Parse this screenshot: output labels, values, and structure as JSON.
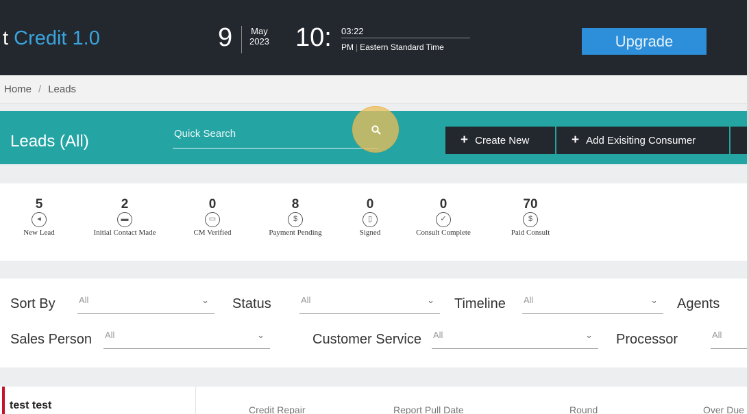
{
  "header": {
    "brand_prefix": "t",
    "brand_name": "Credit 1.0",
    "date": {
      "day": "9",
      "month": "May",
      "year": "2023"
    },
    "time": {
      "hour": "10:",
      "minutes": "03:22",
      "ampm": "PM",
      "timezone": "Eastern Standard Time"
    },
    "upgrade_label": "Upgrade"
  },
  "breadcrumb": {
    "home": "Home",
    "separator": "/",
    "current": "Leads"
  },
  "banner": {
    "title": "Leads (All)",
    "search_placeholder": "Quick Search",
    "create_label": "Create New",
    "add_label": "Add Exisiting Consumer",
    "plus": "+"
  },
  "stats": [
    {
      "count": "5",
      "label": "New Lead",
      "icon": "megaphone-icon",
      "glyph": "◂"
    },
    {
      "count": "2",
      "label": "Initial Contact Made",
      "icon": "chat-icon",
      "glyph": "▬"
    },
    {
      "count": "0",
      "label": "CM Verified",
      "icon": "card-icon",
      "glyph": "▭"
    },
    {
      "count": "8",
      "label": "Payment Pending",
      "icon": "dollar-icon",
      "glyph": "$"
    },
    {
      "count": "0",
      "label": "Signed",
      "icon": "document-icon",
      "glyph": "▯"
    },
    {
      "count": "0",
      "label": "Consult Complete",
      "icon": "check-icon",
      "glyph": "✓"
    },
    {
      "count": "70",
      "label": "Paid Consult",
      "icon": "dollar-check-icon",
      "glyph": "$"
    }
  ],
  "filters": {
    "sort_by": {
      "label": "Sort By",
      "value": "All"
    },
    "status": {
      "label": "Status",
      "value": "All"
    },
    "timeline": {
      "label": "Timeline",
      "value": "All"
    },
    "agents": {
      "label": "Agents"
    },
    "sales_person": {
      "label": "Sales Person",
      "value": "All"
    },
    "customer_service": {
      "label": "Customer Service",
      "value": "All"
    },
    "processor": {
      "label": "Processor",
      "value": "All"
    },
    "chevron": "⌄"
  },
  "row": {
    "name": "test test",
    "columns": [
      "Credit Repair",
      "Report Pull Date",
      "Round",
      "Over Due"
    ]
  },
  "colors": {
    "header_bg": "#23272e",
    "banner_bg": "#25a4a4",
    "accent_blue": "#2d8fd9",
    "row_accent": "#c4122f"
  }
}
